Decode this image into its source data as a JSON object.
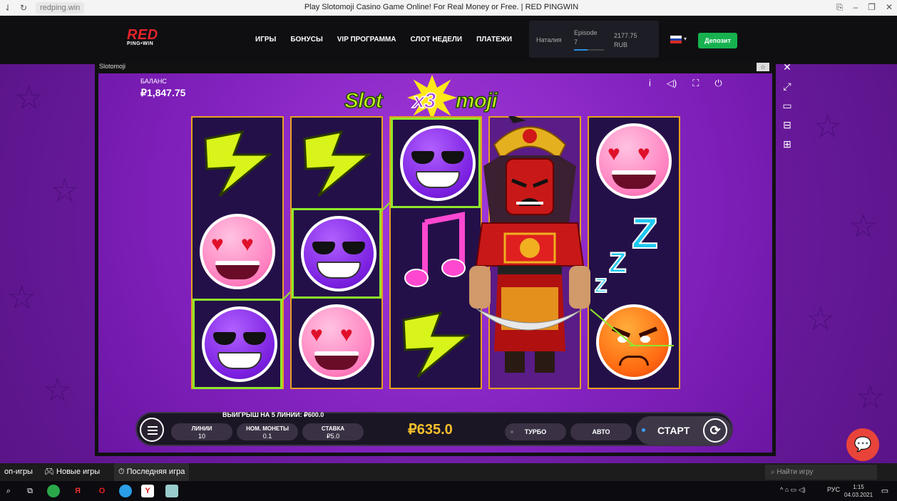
{
  "browser": {
    "url": "redping.win",
    "title": "Play Slotomoji Casino Game Online! For Real Money or Free. | RED PINGWIN"
  },
  "header": {
    "logo_main": "RED",
    "logo_sub": "PING•WIN",
    "nav": [
      "ИГРЫ",
      "БОНУСЫ",
      "VIP ПРОГРАММА",
      "СЛОТ НЕДЕЛИ",
      "ПЛАТЕЖИ"
    ],
    "user_name": "Наталия",
    "episode_label": "Episode",
    "episode_number": "7",
    "episode_progress": 0.45,
    "balance_value": "2177.75",
    "balance_currency": "RUB",
    "deposit_label": "Депозит"
  },
  "game": {
    "window_title": "Slotomoji",
    "balance_label": "БАЛАНС",
    "balance_value": "₽1,847.75",
    "logo_part1": "Slot",
    "logo_x3": "x3",
    "logo_part2": "moji",
    "reels": [
      [
        "bolt",
        "love",
        "cool"
      ],
      [
        "bolt",
        "cool",
        "love"
      ],
      [
        "cool",
        "note",
        "bolt"
      ],
      [
        "samurai",
        "samurai",
        "samurai"
      ],
      [
        "love",
        "zzz",
        "angry"
      ]
    ],
    "win_text": "ВЫИГРЫШ НА 5 ЛИНИИ: ₽600.0",
    "lines_label": "ЛИНИИ",
    "lines_value": "10",
    "coin_label": "НОМ. МОНЕТЫ",
    "coin_value": "0.1",
    "bet_label": "СТАВКА",
    "bet_value": "₽5.0",
    "win_total": "₽635.0",
    "turbo_label": "ТУРБО",
    "auto_label": "АВТО",
    "start_label": "СТАРТ"
  },
  "bottom_tabs": {
    "items": [
      "оп-игры",
      "Новые игры",
      "Последняя игра"
    ],
    "search_placeholder": "Найти игру"
  },
  "taskbar": {
    "lang": "РУС",
    "time": "1:15",
    "date": "04.03.2021"
  },
  "colors": {
    "accent_green": "#8fe82a",
    "reel_border": "#e8a020",
    "deposit_green": "#17b24f",
    "win_gold": "#f6c02c"
  }
}
